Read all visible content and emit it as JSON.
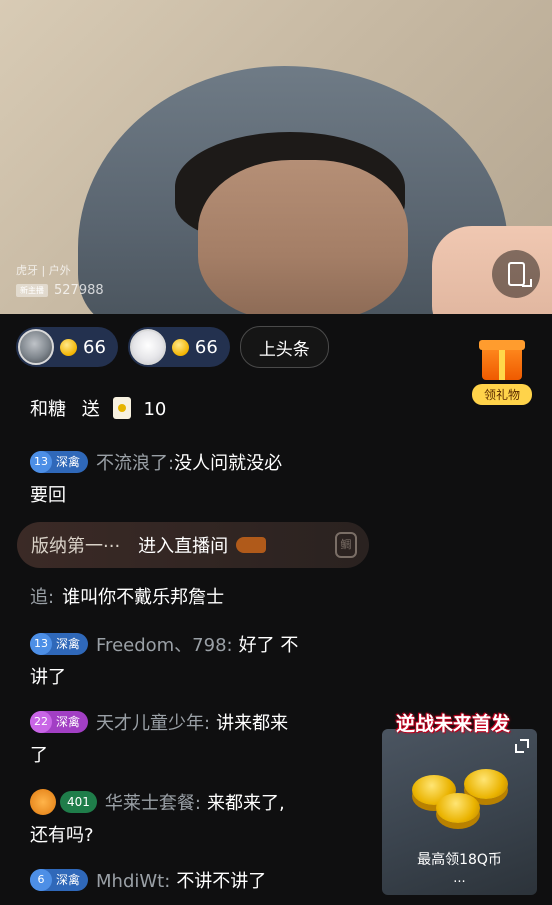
{
  "stream": {
    "platform_tag": "虎牙 | 户外",
    "viewer_badge": "新主播",
    "viewer_count": "527988"
  },
  "top_row": {
    "fans": [
      {
        "count": "66"
      },
      {
        "count": "66"
      }
    ],
    "headline_button": "上头条"
  },
  "gift_widget": {
    "label": "领礼物"
  },
  "chat": {
    "gift_msg": {
      "user": "和糖",
      "verb": "送",
      "amount": "10"
    },
    "messages": [
      {
        "level": "13",
        "badge": "深禽",
        "user": "不流浪了:",
        "text": "没人问就没必",
        "text2": "要回"
      },
      {
        "user": "追:",
        "text": "谁叫你不戴乐邦詹士"
      },
      {
        "level": "13",
        "badge": "深禽",
        "user": "Freedom、798:",
        "text": "好了 不",
        "text2": "讲了"
      },
      {
        "level": "22",
        "badge": "深禽",
        "user": "天才儿童少年:",
        "text": "讲来都来",
        "text2": "了"
      },
      {
        "level": "401",
        "user": "华莱士套餐:",
        "text": "来都来了,",
        "text2": "还有吗?"
      },
      {
        "level": "6",
        "badge": "深禽",
        "user": "MhdiWt:",
        "text": "不讲不讲了"
      }
    ],
    "enter": {
      "user": "版纳第一···",
      "action": "进入直播间",
      "shield": "鲷"
    }
  },
  "ad": {
    "title": "逆战未来首发",
    "caption": "最高领18Q币",
    "more": "···"
  }
}
